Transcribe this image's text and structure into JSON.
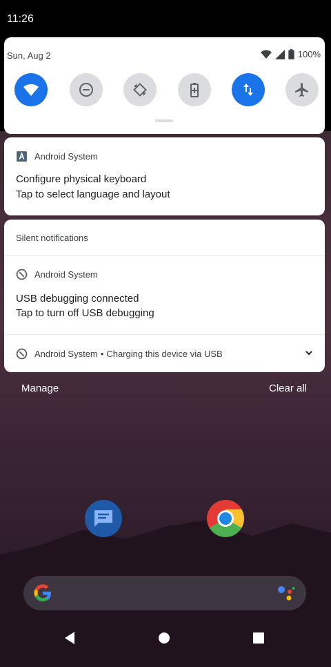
{
  "status_bar": {
    "time": "11:26"
  },
  "quick_settings": {
    "date": "Sun, Aug 2",
    "battery": "100%",
    "tiles": [
      {
        "name": "wifi",
        "icon": "wifi-icon",
        "active": true
      },
      {
        "name": "do-not-disturb",
        "icon": "do-not-disturb-icon",
        "active": false
      },
      {
        "name": "auto-rotate",
        "icon": "auto-rotate-icon",
        "active": false
      },
      {
        "name": "battery-saver",
        "icon": "battery-saver-icon",
        "active": false
      },
      {
        "name": "mobile-data",
        "icon": "mobile-data-icon",
        "active": true
      },
      {
        "name": "airplane-mode",
        "icon": "airplane-icon",
        "active": false
      }
    ],
    "colors": {
      "active": "#1a73e8",
      "inactive": "#dadce0"
    }
  },
  "notifications": {
    "keyboard": {
      "app": "Android System",
      "title": "Configure physical keyboard",
      "text": "Tap to select language and layout"
    },
    "silent_header": "Silent notifications",
    "usb_debugging": {
      "app": "Android System",
      "title": "USB debugging connected",
      "text": "Tap to turn off USB debugging"
    },
    "charging": {
      "app": "Android System",
      "separator": "•",
      "text": "Charging this device via USB"
    }
  },
  "footer": {
    "manage": "Manage",
    "clear_all": "Clear all"
  },
  "home": {
    "apps": [
      "messages-icon",
      "chrome-icon"
    ],
    "search_bar": {
      "icons": [
        "google-g-icon",
        "assistant-icon"
      ]
    }
  },
  "navigation": {
    "buttons": [
      "back-icon",
      "home-icon",
      "recents-icon"
    ]
  }
}
